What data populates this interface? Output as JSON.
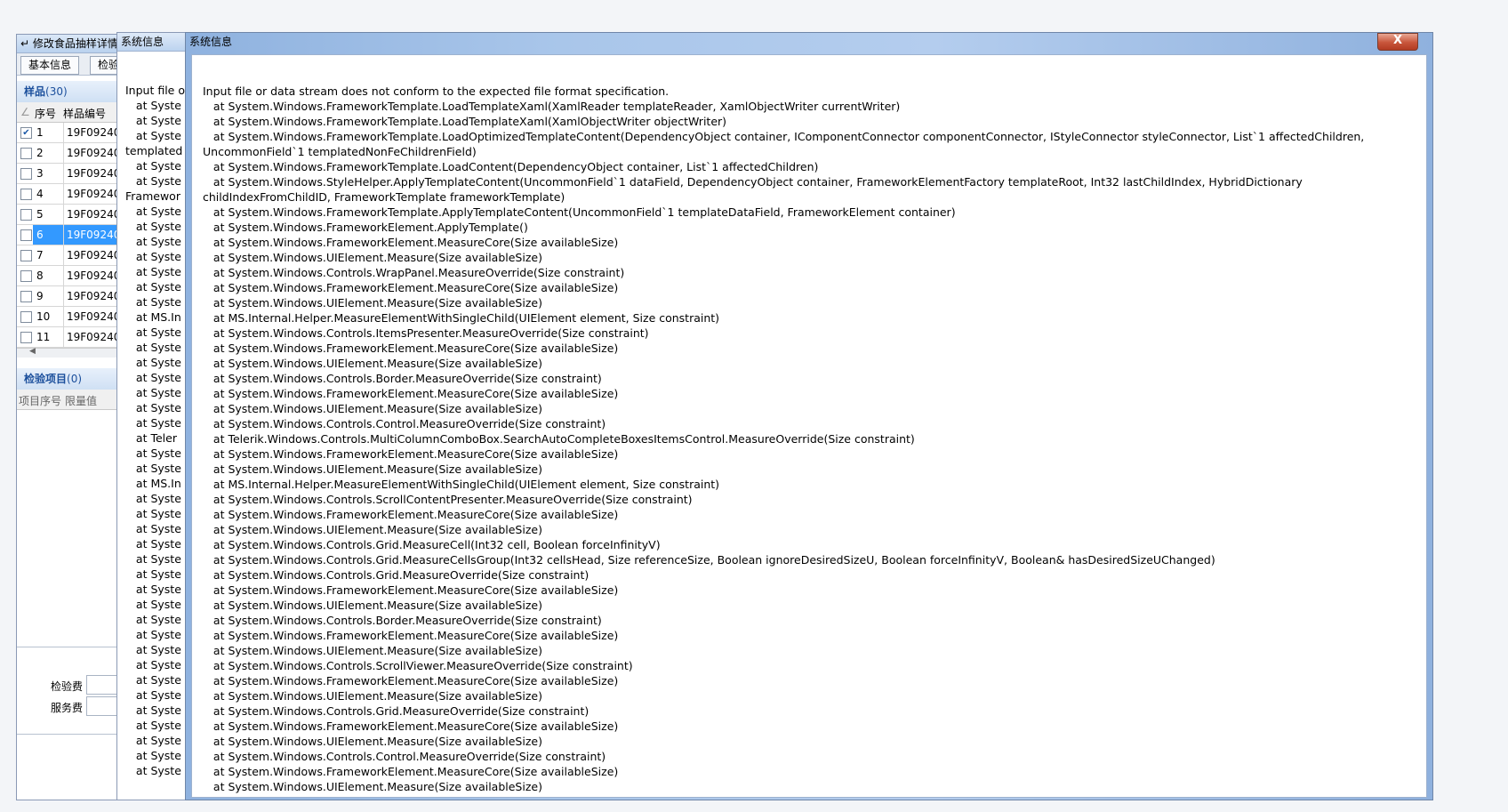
{
  "main_window": {
    "title": "修改食品抽样详情",
    "tabs": [
      "基本信息",
      "检验项目"
    ],
    "samples": {
      "title": "样品",
      "count": "(30)",
      "col_no": "序号",
      "col_code": "样品编号",
      "rows": [
        {
          "no": "1",
          "code": "19F09240",
          "checked": true
        },
        {
          "no": "2",
          "code": "19F09240",
          "checked": false
        },
        {
          "no": "3",
          "code": "19F09240",
          "checked": false
        },
        {
          "no": "4",
          "code": "19F09240",
          "checked": false
        },
        {
          "no": "5",
          "code": "19F09240",
          "checked": false
        },
        {
          "no": "6",
          "code": "19F09240",
          "checked": false
        },
        {
          "no": "7",
          "code": "19F09240",
          "checked": false
        },
        {
          "no": "8",
          "code": "19F09240",
          "checked": false
        },
        {
          "no": "9",
          "code": "19F09240",
          "checked": false
        },
        {
          "no": "10",
          "code": "19F09240",
          "checked": false
        },
        {
          "no": "11",
          "code": "19F09240",
          "checked": false
        }
      ]
    },
    "items": {
      "title": "检验项目",
      "count": "(0)",
      "col_no": "项目序号",
      "col_limit": "限量值"
    },
    "fees": {
      "inspection": "检验费",
      "service": "服务费"
    }
  },
  "mid_window": {
    "title": "系统信息",
    "lines": [
      "Input file o",
      "   at Syste",
      "   at Syste",
      "   at Syste",
      "templated",
      "   at Syste",
      "   at Syste",
      "Framewor",
      "   at Syste",
      "   at Syste",
      "   at Syste",
      "   at Syste",
      "   at Syste",
      "   at Syste",
      "   at Syste",
      "   at MS.In",
      "   at Syste",
      "   at Syste",
      "   at Syste",
      "   at Syste",
      "   at Syste",
      "   at Syste",
      "   at Syste",
      "   at Teler",
      "   at Syste",
      "   at Syste",
      "   at MS.In",
      "   at Syste",
      "   at Syste",
      "   at Syste",
      "   at Syste",
      "   at Syste",
      "   at Syste",
      "   at Syste",
      "   at Syste",
      "   at Syste",
      "   at Syste",
      "   at Syste",
      "   at Syste",
      "   at Syste",
      "   at Syste",
      "   at Syste",
      "   at Syste",
      "   at Syste",
      "   at Syste",
      "   at Syste"
    ]
  },
  "error_window": {
    "title": "系统信息",
    "close_label": "X",
    "message": "Input file or data stream does not conform to the expected file format specification.\n   at System.Windows.FrameworkTemplate.LoadTemplateXaml(XamlReader templateReader, XamlObjectWriter currentWriter)\n   at System.Windows.FrameworkTemplate.LoadTemplateXaml(XamlObjectWriter objectWriter)\n   at System.Windows.FrameworkTemplate.LoadOptimizedTemplateContent(DependencyObject container, IComponentConnector componentConnector, IStyleConnector styleConnector, List`1 affectedChildren, UncommonField`1 templatedNonFeChildrenField)\n   at System.Windows.FrameworkTemplate.LoadContent(DependencyObject container, List`1 affectedChildren)\n   at System.Windows.StyleHelper.ApplyTemplateContent(UncommonField`1 dataField, DependencyObject container, FrameworkElementFactory templateRoot, Int32 lastChildIndex, HybridDictionary childIndexFromChildID, FrameworkTemplate frameworkTemplate)\n   at System.Windows.FrameworkTemplate.ApplyTemplateContent(UncommonField`1 templateDataField, FrameworkElement container)\n   at System.Windows.FrameworkElement.ApplyTemplate()\n   at System.Windows.FrameworkElement.MeasureCore(Size availableSize)\n   at System.Windows.UIElement.Measure(Size availableSize)\n   at System.Windows.Controls.WrapPanel.MeasureOverride(Size constraint)\n   at System.Windows.FrameworkElement.MeasureCore(Size availableSize)\n   at System.Windows.UIElement.Measure(Size availableSize)\n   at MS.Internal.Helper.MeasureElementWithSingleChild(UIElement element, Size constraint)\n   at System.Windows.Controls.ItemsPresenter.MeasureOverride(Size constraint)\n   at System.Windows.FrameworkElement.MeasureCore(Size availableSize)\n   at System.Windows.UIElement.Measure(Size availableSize)\n   at System.Windows.Controls.Border.MeasureOverride(Size constraint)\n   at System.Windows.FrameworkElement.MeasureCore(Size availableSize)\n   at System.Windows.UIElement.Measure(Size availableSize)\n   at System.Windows.Controls.Control.MeasureOverride(Size constraint)\n   at Telerik.Windows.Controls.MultiColumnComboBox.SearchAutoCompleteBoxesItemsControl.MeasureOverride(Size constraint)\n   at System.Windows.FrameworkElement.MeasureCore(Size availableSize)\n   at System.Windows.UIElement.Measure(Size availableSize)\n   at MS.Internal.Helper.MeasureElementWithSingleChild(UIElement element, Size constraint)\n   at System.Windows.Controls.ScrollContentPresenter.MeasureOverride(Size constraint)\n   at System.Windows.FrameworkElement.MeasureCore(Size availableSize)\n   at System.Windows.UIElement.Measure(Size availableSize)\n   at System.Windows.Controls.Grid.MeasureCell(Int32 cell, Boolean forceInfinityV)\n   at System.Windows.Controls.Grid.MeasureCellsGroup(Int32 cellsHead, Size referenceSize, Boolean ignoreDesiredSizeU, Boolean forceInfinityV, Boolean& hasDesiredSizeUChanged)\n   at System.Windows.Controls.Grid.MeasureOverride(Size constraint)\n   at System.Windows.FrameworkElement.MeasureCore(Size availableSize)\n   at System.Windows.UIElement.Measure(Size availableSize)\n   at System.Windows.Controls.Border.MeasureOverride(Size constraint)\n   at System.Windows.FrameworkElement.MeasureCore(Size availableSize)\n   at System.Windows.UIElement.Measure(Size availableSize)\n   at System.Windows.Controls.ScrollViewer.MeasureOverride(Size constraint)\n   at System.Windows.FrameworkElement.MeasureCore(Size availableSize)\n   at System.Windows.UIElement.Measure(Size availableSize)\n   at System.Windows.Controls.Grid.MeasureOverride(Size constraint)\n   at System.Windows.FrameworkElement.MeasureCore(Size availableSize)\n   at System.Windows.UIElement.Measure(Size availableSize)\n   at System.Windows.Controls.Control.MeasureOverride(Size constraint)\n   at System.Windows.FrameworkElement.MeasureCore(Size availableSize)\n   at System.Windows.UIElement.Measure(Size availableSize)"
  }
}
